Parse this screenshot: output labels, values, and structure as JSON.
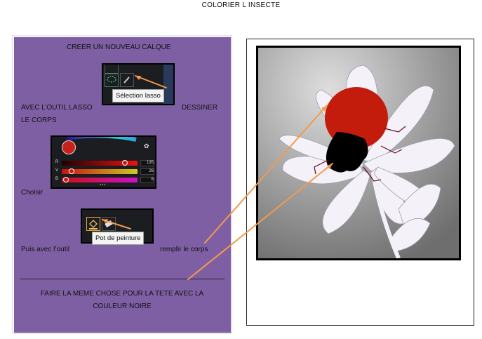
{
  "title": "COLORIER L INSECTE",
  "instructions": {
    "new_layer": "CREER UN NOUVEAU  CALQUE",
    "lasso_left": "AVEC L’OUTIL LASSO",
    "lasso_right": "DESSINER",
    "lasso_second": "LE CORPS",
    "choose": "Choisir",
    "bucket_left": "Puis avec l’outil",
    "bucket_right": "remplir le corps",
    "head_line1": "FAIRE LA MEME CHOSE POUR LA TETE AVEC LA",
    "head_line2": "COULEUR NOIRE"
  },
  "lasso_screenshot": {
    "tooltip": "Sélection lasso",
    "tool_icon": "lasso-icon"
  },
  "color_screenshot": {
    "swatch_color": "#c8201a",
    "sliders": [
      {
        "label": "R",
        "value": "195"
      },
      {
        "label": "V",
        "value": "26"
      },
      {
        "label": "B",
        "value": "6"
      }
    ]
  },
  "bucket_screenshot": {
    "tooltip": "Pot de peinture",
    "tool_icon": "paint-bucket-icon"
  },
  "colors": {
    "panel": "#7f5fa4",
    "body_red": "#c31c0c",
    "head_black": "#000000",
    "arrow_orange": "#f39a4c"
  }
}
